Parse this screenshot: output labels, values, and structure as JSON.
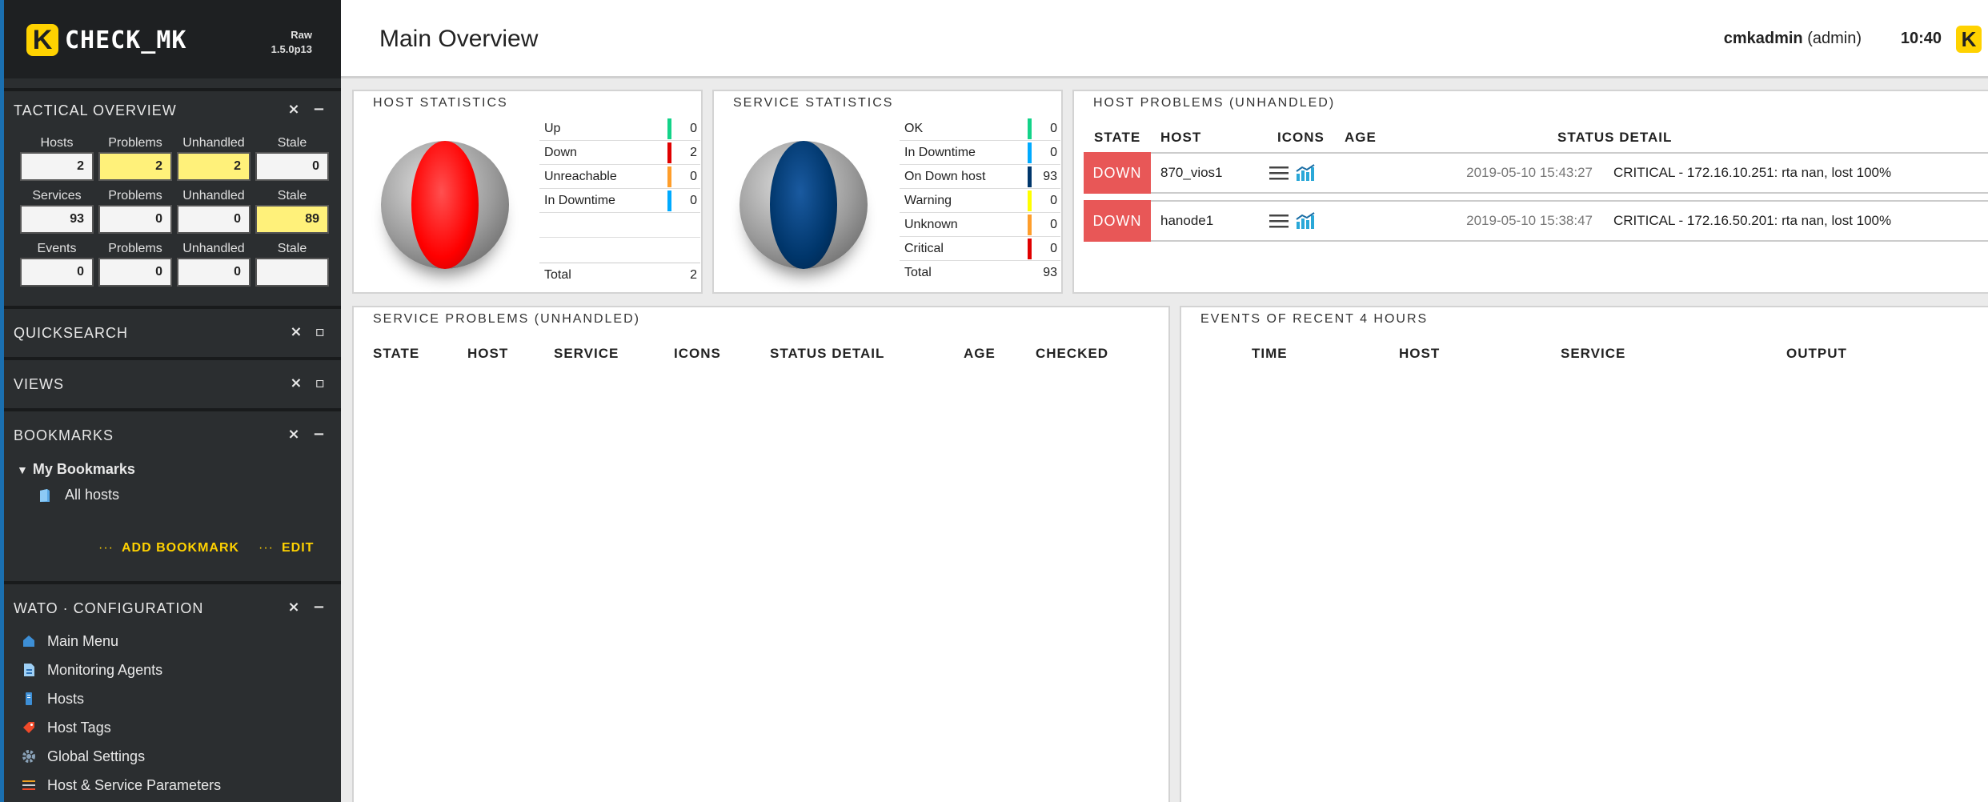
{
  "brand": {
    "logo_letter": "K",
    "name": "CHECK_MK",
    "edition": "Raw",
    "version": "1.5.0p13"
  },
  "header": {
    "title": "Main Overview",
    "user": "cmkadmin",
    "role": "(admin)",
    "time": "10:40"
  },
  "sidebar": {
    "tactical": {
      "title": "TACTICAL OVERVIEW",
      "rows": [
        {
          "label": "Hosts",
          "values": [
            "2",
            "2",
            "2",
            "0"
          ]
        },
        {
          "label": "Services",
          "values": [
            "93",
            "0",
            "0",
            "89"
          ]
        },
        {
          "label": "Events",
          "values": [
            "0",
            "0",
            "0",
            ""
          ]
        }
      ],
      "col_labels": [
        "Problems",
        "Unhandled",
        "Stale"
      ]
    },
    "quicksearch": {
      "title": "QUICKSEARCH"
    },
    "views": {
      "title": "VIEWS"
    },
    "bookmarks": {
      "title": "BOOKMARKS",
      "folder": "My Bookmarks",
      "item": "All hosts",
      "add": "ADD BOOKMARK",
      "edit": "EDIT",
      "dots": "···"
    },
    "wato": {
      "title": "WATO · CONFIGURATION",
      "items": [
        "Main Menu",
        "Monitoring Agents",
        "Hosts",
        "Host Tags",
        "Global Settings",
        "Host & Service Parameters"
      ]
    },
    "controls": {
      "close": "×",
      "min": "−",
      "max": "▫"
    }
  },
  "host_stats": {
    "title": "HOST STATISTICS",
    "rows": [
      {
        "name": "Up",
        "value": "0",
        "color": "#13d389"
      },
      {
        "name": "Down",
        "value": "2",
        "color": "#e00000"
      },
      {
        "name": "Unreachable",
        "value": "0",
        "color": "#ff9e2b"
      },
      {
        "name": "In Downtime",
        "value": "0",
        "color": "#00aaff"
      }
    ],
    "total_label": "Total",
    "total": "2"
  },
  "service_stats": {
    "title": "SERVICE STATISTICS",
    "rows": [
      {
        "name": "OK",
        "value": "0",
        "color": "#13d389"
      },
      {
        "name": "In Downtime",
        "value": "0",
        "color": "#00aaff"
      },
      {
        "name": "On Down host",
        "value": "93",
        "color": "#00366b"
      },
      {
        "name": "Warning",
        "value": "0",
        "color": "#ffff00"
      },
      {
        "name": "Unknown",
        "value": "0",
        "color": "#ff9e2b"
      },
      {
        "name": "Critical",
        "value": "0",
        "color": "#e00000"
      }
    ],
    "total_label": "Total",
    "total": "93"
  },
  "host_problems": {
    "title": "HOST PROBLEMS (UNHANDLED)",
    "headers": [
      "STATE",
      "HOST",
      "ICONS",
      "AGE",
      "STATUS DETAIL"
    ],
    "rows": [
      {
        "state": "DOWN",
        "host": "870_vios1",
        "age": "2019-05-10 15:43:27",
        "detail": "CRITICAL - 172.16.10.251: rta nan, lost 100%"
      },
      {
        "state": "DOWN",
        "host": "hanode1",
        "age": "2019-05-10 15:38:47",
        "detail": "CRITICAL - 172.16.50.201: rta nan, lost 100%"
      }
    ]
  },
  "service_problems": {
    "title": "SERVICE PROBLEMS (UNHANDLED)",
    "headers": [
      "STATE",
      "HOST",
      "SERVICE",
      "ICONS",
      "STATUS DETAIL",
      "AGE",
      "CHECKED"
    ]
  },
  "events": {
    "title": "EVENTS OF RECENT 4 HOURS",
    "headers": [
      "TIME",
      "HOST",
      "SERVICE",
      "OUTPUT"
    ]
  }
}
